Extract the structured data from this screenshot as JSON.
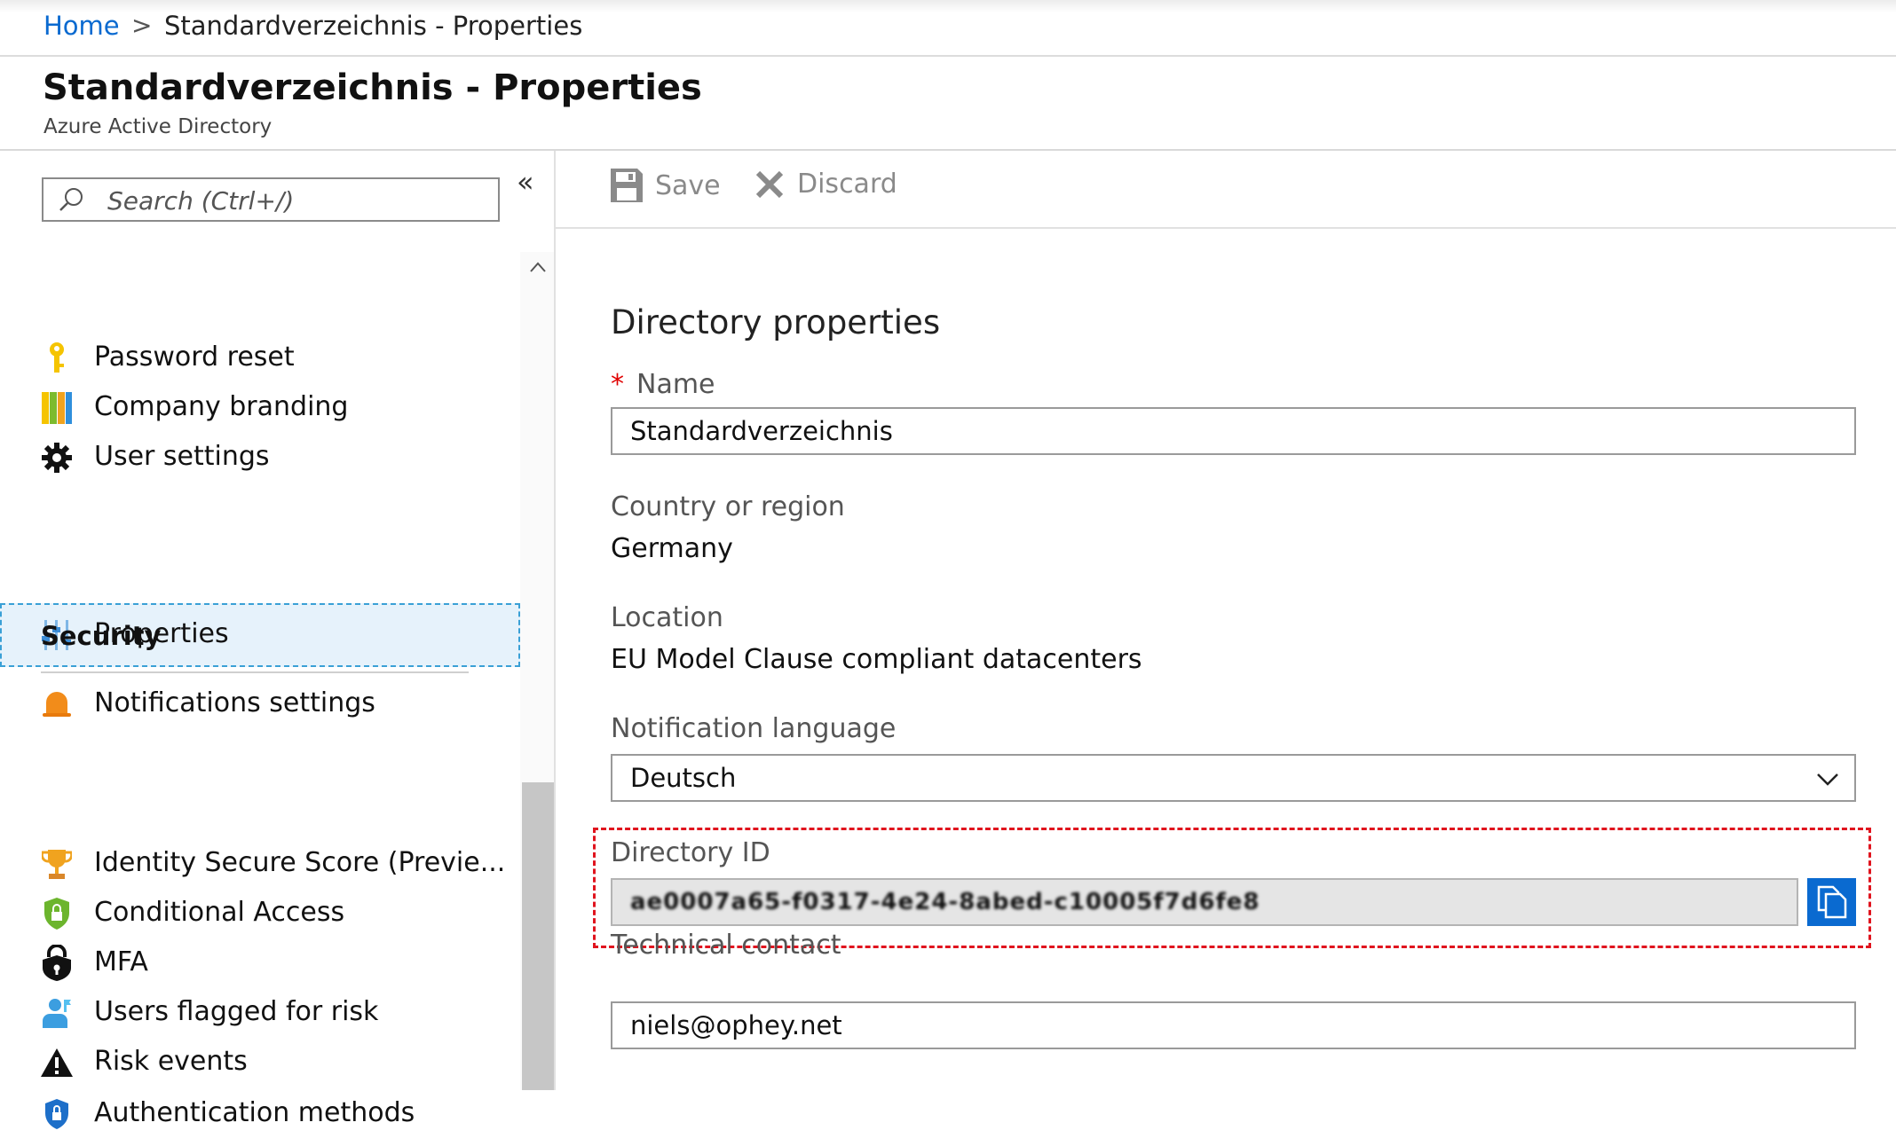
{
  "breadcrumb": {
    "home": "Home",
    "separator": ">",
    "current": "Standardverzeichnis - Properties"
  },
  "header": {
    "title": "Standardverzeichnis - Properties",
    "subtitle": "Azure Active Directory"
  },
  "sidebar": {
    "search_placeholder": "Search (Ctrl+/)",
    "collapse_glyph": "«",
    "items": [
      {
        "label": "Password reset",
        "icon": "key-icon"
      },
      {
        "label": "Company branding",
        "icon": "branding-icon"
      },
      {
        "label": "User settings",
        "icon": "gear-icon"
      },
      {
        "label": "Properties",
        "icon": "properties-icon",
        "active": true
      },
      {
        "label": "Notifications settings",
        "icon": "bell-icon"
      }
    ],
    "security_heading": "Security",
    "security_items": [
      {
        "label": "Identity Secure Score (Previe...",
        "icon": "trophy-icon"
      },
      {
        "label": "Conditional Access",
        "icon": "shield-lock-icon"
      },
      {
        "label": "MFA",
        "icon": "lock-shield-icon"
      },
      {
        "label": "Users flagged for risk",
        "icon": "user-flag-icon"
      },
      {
        "label": "Risk events",
        "icon": "warning-icon"
      },
      {
        "label": "Authentication methods",
        "icon": "shield-icon"
      }
    ]
  },
  "toolbar": {
    "save_label": "Save",
    "discard_label": "Discard"
  },
  "form": {
    "section_title": "Directory properties",
    "required_mark": "*",
    "name_label": "Name",
    "name_value": "Standardverzeichnis",
    "country_label": "Country or region",
    "country_value": "Germany",
    "location_label": "Location",
    "location_value": "EU Model Clause compliant datacenters",
    "notification_label": "Notification language",
    "notification_value": "Deutsch",
    "directory_id_label": "Directory ID",
    "directory_id_value": "ae0007a65-f0317-4e24-8abed-c10005f7d6fe8",
    "technical_contact_label": "Technical contact",
    "technical_contact_value": "niels@ophey.net"
  },
  "colors": {
    "accent": "#0a6ad0",
    "highlight": "#e0141e",
    "active_bg": "#e6f2fb"
  }
}
